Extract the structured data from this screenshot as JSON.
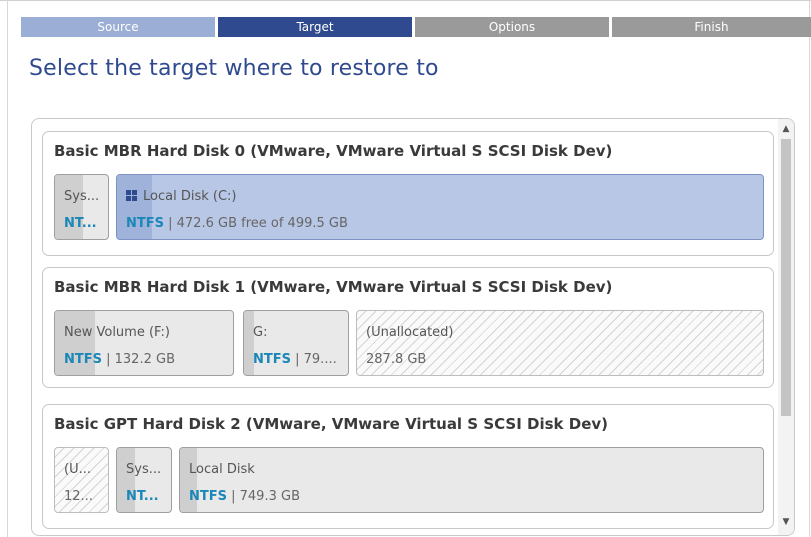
{
  "steps": [
    {
      "label": "Source",
      "state": "done"
    },
    {
      "label": "Target",
      "state": "active"
    },
    {
      "label": "Options",
      "state": "todo"
    },
    {
      "label": "Finish",
      "state": "todo"
    }
  ],
  "heading": "Select the target where to restore to",
  "colors": {
    "accent": "#2f4a8f",
    "fs_label": "#1a87b8",
    "selected_partition": "#b8c7e5"
  },
  "disks": [
    {
      "title": "Basic MBR Hard Disk 0 (VMware, VMware Virtual S SCSI Disk Dev)",
      "partitions": [
        {
          "name": "Sys...",
          "fs": "NT...",
          "detail": ""
        },
        {
          "name": "Local Disk (C:)",
          "icon": "windows-icon",
          "fs": "NTFS",
          "detail": " | 472.6 GB free of 499.5 GB",
          "selected": true
        }
      ]
    },
    {
      "title": "Basic MBR Hard Disk 1 (VMware, VMware Virtual S SCSI Disk Dev)",
      "partitions": [
        {
          "name": "New Volume (F:)",
          "fs": "NTFS",
          "detail": " | 132.2 GB"
        },
        {
          "name": "G:",
          "fs": "NTFS",
          "detail": " | 79...."
        },
        {
          "name": "(Unallocated)",
          "detail": "287.8 GB",
          "unallocated": true
        }
      ]
    },
    {
      "title": "Basic GPT Hard Disk 2 (VMware, VMware Virtual S SCSI Disk Dev)",
      "partitions": [
        {
          "name": "(U...",
          "detail": "12...",
          "unallocated": true
        },
        {
          "name": "Sys...",
          "fs": "NT...",
          "detail": ""
        },
        {
          "name": "Local Disk",
          "fs": "NTFS",
          "detail": " | 749.3 GB"
        }
      ]
    }
  ],
  "scrollbar": {
    "up_icon": "▲",
    "down_icon": "▼"
  }
}
